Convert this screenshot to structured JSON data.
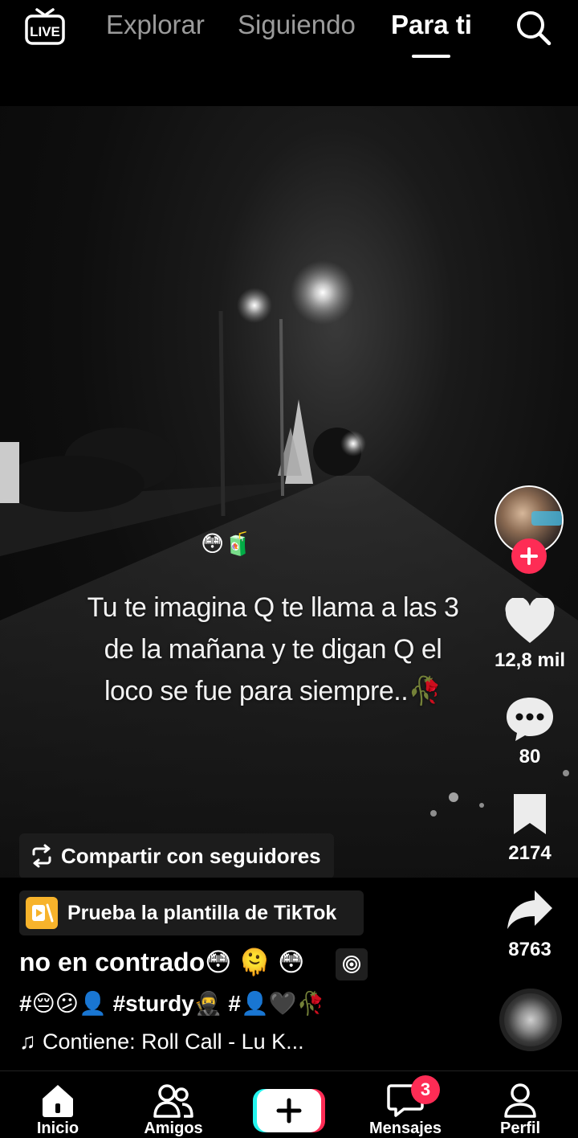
{
  "header": {
    "live_label": "LIVE",
    "tabs": [
      {
        "label": "Explorar"
      },
      {
        "label": "Siguiendo"
      },
      {
        "label": "Para ti",
        "active": true
      }
    ]
  },
  "video": {
    "caption_emoji": "😳🧃",
    "overlay_text": "Tu te imagina Q te llama a las 3 de la mañana y te digan Q el loco se fue para siempre..🥀",
    "share_chip_label": "Compartir con seguidores"
  },
  "sidebar": {
    "like_count": "12,8 mil",
    "comment_count": "80",
    "save_count": "2174",
    "share_count": "8763"
  },
  "post": {
    "template_label": "Prueba la plantilla de TikTok",
    "description": "no en contrado😳 🫠 😳",
    "hashtags": "#😔😕👤 #sturdy🥷 #👤🖤🥀",
    "music": "Contiene: Roll Call - Lu K..."
  },
  "bottom_nav": {
    "items": [
      {
        "label": "Inicio"
      },
      {
        "label": "Amigos"
      },
      {
        "label": "Mensajes"
      },
      {
        "label": "Perfil"
      }
    ],
    "messages_badge": "3"
  },
  "colors": {
    "accent": "#fe2c55",
    "template_icon": "#f7b32b",
    "inactive_tab": "#9b9b9b"
  },
  "icons": [
    "live-icon",
    "search-icon",
    "plus-icon",
    "heart-icon",
    "comment-icon",
    "bookmark-icon",
    "share-icon",
    "repost-icon",
    "template-icon",
    "effect-icon",
    "music-note-icon",
    "home-icon",
    "friends-icon",
    "create-icon",
    "messages-icon",
    "profile-icon"
  ]
}
